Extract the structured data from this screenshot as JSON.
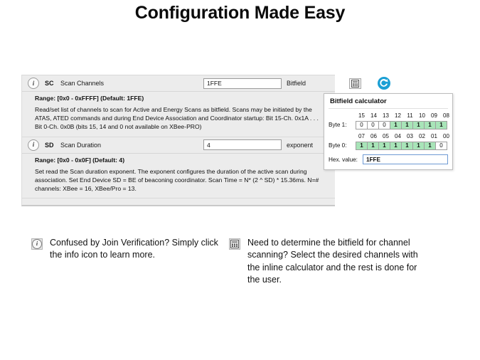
{
  "slide": {
    "title": "Configuration Made Easy"
  },
  "panel": {
    "parameters": [
      {
        "info_icon": "info-icon",
        "code": "SC",
        "name": "Scan Channels",
        "value": "1FFE",
        "unit": "Bitfield",
        "range_line": "Range: [0x0 - 0xFFFF] (Default: 1FFE)",
        "description": "Read/set list of channels to scan for Active and Energy Scans as bitfield. Scans may be initiated by the ATAS, ATED commands and during End Device Association and Coordinator startup: Bit 15-Ch. 0x1A . . . Bit 0-Ch. 0x0B (bits 15, 14 and 0 not available on XBee-PRO)",
        "calc_icon": "calculator-icon",
        "refresh_icon": "refresh-icon"
      },
      {
        "info_icon": "info-icon",
        "code": "SD",
        "name": "Scan Duration",
        "value": "4",
        "unit": "exponent",
        "range_line": "Range: [0x0 - 0x0F] (Default: 4)",
        "description": "Set read the Scan duration exponent. The exponent configures the duration of the active scan during association. Set End Device SD = BE of beaconing coordinator. Scan Time = N* (2 ^ SD) * 15.36ms. N=# channels: XBee = 16, XBee/Pro = 13."
      }
    ]
  },
  "bitfield_calculator": {
    "title": "Bitfield calculator",
    "byte1": {
      "label": "Byte 1:",
      "bit_labels": [
        "15",
        "14",
        "13",
        "12",
        "11",
        "10",
        "09",
        "08"
      ],
      "bits": [
        "0",
        "0",
        "0",
        "1",
        "1",
        "1",
        "1",
        "1"
      ]
    },
    "byte0": {
      "label": "Byte 0:",
      "bit_labels": [
        "07",
        "06",
        "05",
        "04",
        "03",
        "02",
        "01",
        "00"
      ],
      "bits": [
        "1",
        "1",
        "1",
        "1",
        "1",
        "1",
        "1",
        "0"
      ]
    },
    "hex_label": "Hex. value:",
    "hex_value": "1FFE",
    "colors": {
      "bit_on": "#a8e4b8",
      "hex_border": "#6e9ad4"
    }
  },
  "annotations": [
    {
      "icon": "info-icon",
      "text": "Confused by Join Verification? Simply click the info icon to learn more."
    },
    {
      "icon": "calculator-icon",
      "text": "Need to determine the bitfield for channel scanning? Select the desired channels with the inline calculator and the rest is done for the user."
    }
  ]
}
